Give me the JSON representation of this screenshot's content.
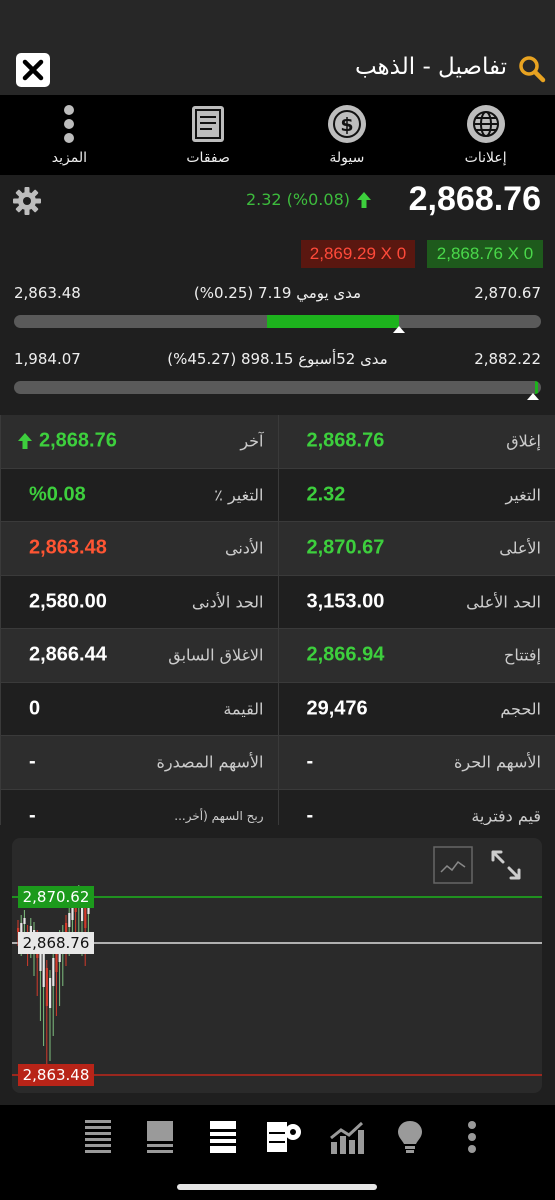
{
  "header": {
    "title": "تفاصيل - الذهب"
  },
  "topnav": [
    {
      "label": "إعلانات",
      "icon": "globe-icon"
    },
    {
      "label": "سيولة",
      "icon": "dollar-icon"
    },
    {
      "label": "صفقات",
      "icon": "document-icon"
    },
    {
      "label": "المزيد",
      "icon": "more-vertical-icon"
    }
  ],
  "quote": {
    "price": "2,868.76",
    "change": "2.32 (%0.08)",
    "bid": "2,869.29 X 0",
    "ask": "2,868.76 X 0"
  },
  "daily_range": {
    "low": "2,863.48",
    "high": "2,870.67",
    "label": "مدى يومي 7.19 (0.25%)",
    "fill_start": 0.48,
    "fill_end": 0.73,
    "marker": 0.73
  },
  "week52_range": {
    "low": "1,984.07",
    "high": "2,882.22",
    "label": "مدى 52أسبوع 898.15 (45.27%)",
    "marker": 0.985
  },
  "table": [
    {
      "rk": "إغلاق",
      "rv": "2,868.76",
      "rc": "green",
      "lk": "آخر",
      "lv": "2,868.76",
      "lc": "green",
      "larrow": true
    },
    {
      "rk": "التغير",
      "rv": "2.32",
      "rc": "green",
      "lk": "التغير ٪",
      "lv": "%0.08",
      "lc": "green"
    },
    {
      "rk": "الأعلى",
      "rv": "2,870.67",
      "rc": "green",
      "lk": "الأدنى",
      "lv": "2,863.48",
      "lc": "red"
    },
    {
      "rk": "الحد الأعلى",
      "rv": "3,153.00",
      "rc": "",
      "lk": "الحد الأدنى",
      "lv": "2,580.00",
      "lc": ""
    },
    {
      "rk": "إفتتاح",
      "rv": "2,866.94",
      "rc": "green",
      "lk": "الاغلاق السابق",
      "lv": "2,866.44",
      "lc": ""
    },
    {
      "rk": "الحجم",
      "rv": "29,476",
      "rc": "",
      "lk": "القيمة",
      "lv": "0",
      "lc": ""
    },
    {
      "rk": "الأسهم الحرة",
      "rv": "-",
      "rc": "",
      "lk": "الأسهم المصدرة",
      "lv": "-",
      "lc": ""
    },
    {
      "rk": "قيم دفترية",
      "rv": "-",
      "rc": "",
      "lk": "ربح السهم (أخر...",
      "lv": "-",
      "lc": ""
    }
  ],
  "chart": {
    "high_label": "2,870.62",
    "last_label": "2,868.76",
    "low_label": "2,863.48",
    "colors": {
      "high": "#1db31d",
      "last": "#dddddd",
      "low": "#c0261a"
    }
  },
  "bottom_icons": [
    "list-icon",
    "quotes-icon",
    "details-icon",
    "settings-panel-icon",
    "chart-icon",
    "idea-icon",
    "more-icon"
  ]
}
